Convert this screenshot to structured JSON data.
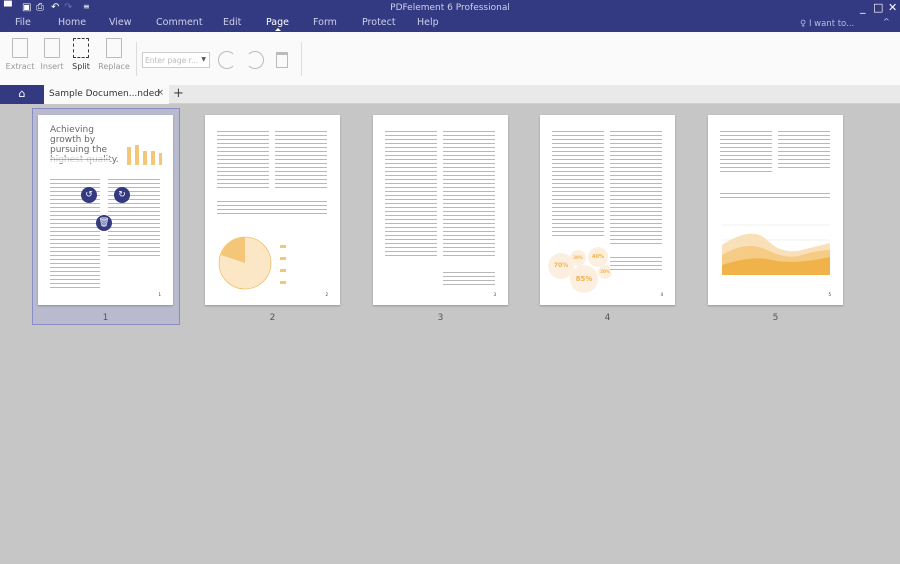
{
  "app": {
    "title": "PDFelement 6 Professional"
  },
  "quick_access": {
    "icons": [
      "app-logo-icon",
      "save-icon",
      "print-icon",
      "undo-icon",
      "redo-icon",
      "customize-icon"
    ]
  },
  "menu": {
    "items": [
      "File",
      "Home",
      "View",
      "Comment",
      "Edit",
      "Page",
      "Form",
      "Protect",
      "Help"
    ],
    "active": "Page",
    "search_label": "I want to..."
  },
  "toolbar": {
    "extract": "Extract",
    "insert": "Insert",
    "split": "Split",
    "replace": "Replace",
    "page_range_placeholder": "Enter page r..."
  },
  "tabs": {
    "doc": "Sample Documen...nded",
    "close": "×",
    "add": "+"
  },
  "pages": [
    {
      "number": "1",
      "heading": "Achieving growth by pursuing the highest quality.",
      "selected": true
    },
    {
      "number": "2"
    },
    {
      "number": "3"
    },
    {
      "number": "4",
      "bubbles": [
        "70%",
        "30%",
        "40%",
        "85%",
        "20%"
      ]
    },
    {
      "number": "5"
    }
  ],
  "colors": {
    "brand": "#333a82",
    "accent": "#f0b34a"
  }
}
